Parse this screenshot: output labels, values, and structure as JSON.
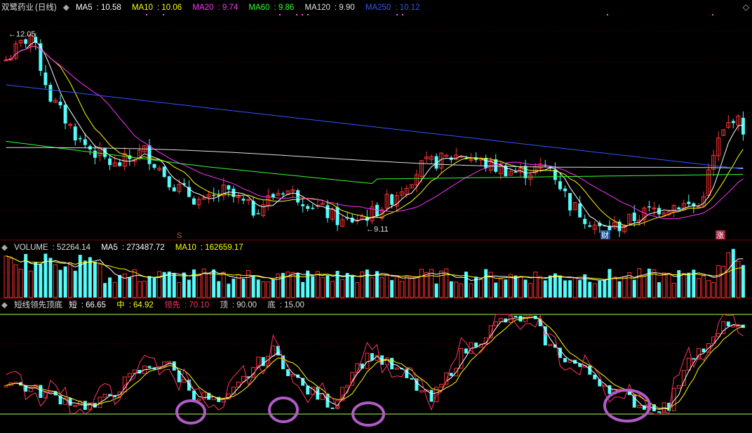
{
  "stock": {
    "name": "双鹭药业",
    "period": "(日线)"
  },
  "main_indicators": [
    {
      "label": "MA5",
      "value": "10.58",
      "color": "#ffffff"
    },
    {
      "label": "MA10",
      "value": "10.06",
      "color": "#ffff00"
    },
    {
      "label": "MA20",
      "value": "9.74",
      "color": "#ff33ff"
    },
    {
      "label": "MA60",
      "value": "9.86",
      "color": "#33ff33"
    },
    {
      "label": "MA120",
      "value": "9.90",
      "color": "#e0e0e0"
    },
    {
      "label": "MA250",
      "value": "10.12",
      "color": "#3355ff"
    }
  ],
  "price_marks": {
    "high": "12.05",
    "low": "9.11"
  },
  "event_markers": {
    "s_marker": "S",
    "cai_marker": "财",
    "zhang_marker": "涨"
  },
  "volume_indicators": [
    {
      "label": "VOLUME",
      "value": "52264.14",
      "color": "#dddddd"
    },
    {
      "label": "MA5",
      "value": "273487.72",
      "color": "#ffffff"
    },
    {
      "label": "MA10",
      "value": "162659.17",
      "color": "#ffff00"
    }
  ],
  "oscillator": {
    "name": "短线领先顶底",
    "items": [
      {
        "label": "短",
        "value": "66.65",
        "color": "#ffffff"
      },
      {
        "label": "中",
        "value": "64.92",
        "color": "#ffff00"
      },
      {
        "label": "领先",
        "value": "70.10",
        "color": "#ff3366"
      },
      {
        "label": "顶",
        "value": "90.00",
        "color": "#dddddd"
      },
      {
        "label": "底",
        "value": "15.00",
        "color": "#dddddd"
      }
    ]
  },
  "colors": {
    "up": "#ff3232",
    "down": "#54fcfc",
    "grid": "#5a0000",
    "circle": "#b05cc8",
    "hline": "#88cc44"
  }
}
